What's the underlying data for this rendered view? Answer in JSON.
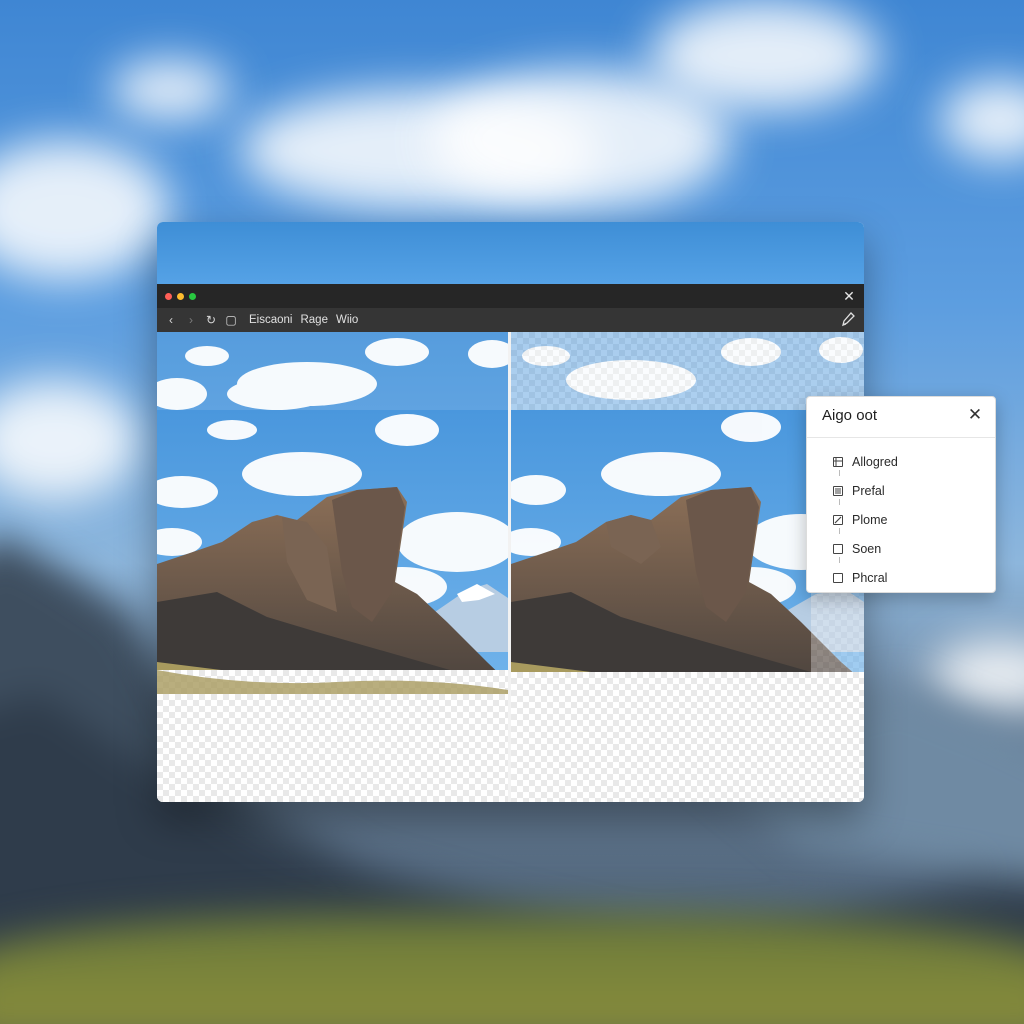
{
  "window": {
    "close_glyph": "✕",
    "nav": {
      "back_glyph": "‹",
      "forward_glyph": "›",
      "refresh_glyph": "↻",
      "page_glyph": "▢"
    },
    "menu": [
      "Eiscaoni",
      "Rage",
      "Wiio"
    ],
    "pen_icon": "pen-icon"
  },
  "panel": {
    "title": "Aigo oot",
    "close_glyph": "✕",
    "items": [
      {
        "label": "Allogred",
        "icon": "grid-icon"
      },
      {
        "label": "Prefal",
        "icon": "list-icon"
      },
      {
        "label": "Plome",
        "icon": "edit-icon"
      },
      {
        "label": "Soen",
        "icon": "checkbox-icon"
      },
      {
        "label": "Phcral",
        "icon": "checkbox-icon"
      }
    ]
  },
  "colors": {
    "titlebar": "#262626",
    "toolbar": "#353535",
    "sky": "#3e8ed6",
    "traffic_red": "#ff5f57",
    "traffic_yellow": "#febc2e",
    "traffic_green": "#28c840"
  }
}
